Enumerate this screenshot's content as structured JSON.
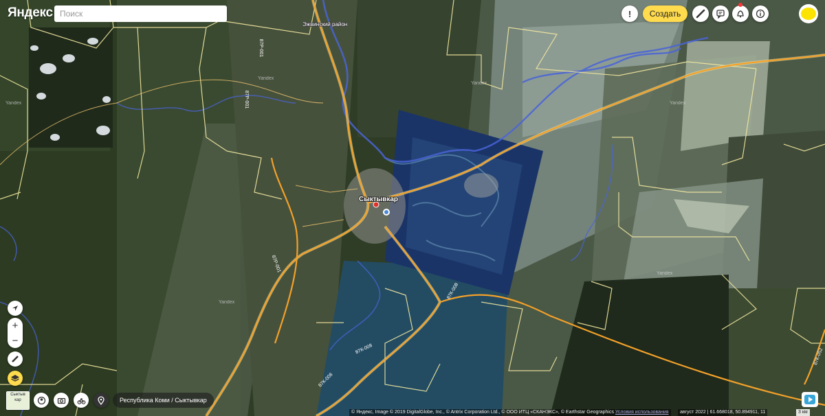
{
  "header": {
    "logo": "Яндекс",
    "search_placeholder": "Поиск",
    "create_label": "Создать"
  },
  "map": {
    "city_label": "Сыктывкар",
    "district_label": "Эжвинский район",
    "watermark": "Yandex",
    "road_labels": [
      "87Р-001",
      "87Р-001",
      "87Р-001",
      "87К-008",
      "87К-008",
      "87К-008",
      "87К-052"
    ],
    "colors": {
      "road_major": "#f4a12a",
      "road_border": "#f2e8a0",
      "river": "#4a64d8",
      "city_pin": "#e0302a"
    }
  },
  "controls": {
    "zoom_in": "+",
    "zoom_out": "−",
    "minimap_label": "Сыктыв\nкар"
  },
  "footer": {
    "region": "Республика Коми / Сыктывкар",
    "attribution": "© Яндекс, Image © 2019 DigitalGlobe, Inc., © Antrix Corporation Ltd., © ООО ИТЦ «СКАНЭКС», © Earthstar Geographics",
    "terms_link": "Условия использования",
    "date_coords": "август 2022 | 61.668018, 50.894911, 11",
    "scale": "3 км"
  },
  "icons": [
    "alert-icon",
    "ruler-icon",
    "feedback-icon",
    "bell-icon",
    "info-icon",
    "navigate-icon",
    "measure-icon",
    "layers-icon",
    "panorama-icon",
    "camera-icon",
    "bike-icon",
    "pin-icon",
    "play-icon"
  ]
}
